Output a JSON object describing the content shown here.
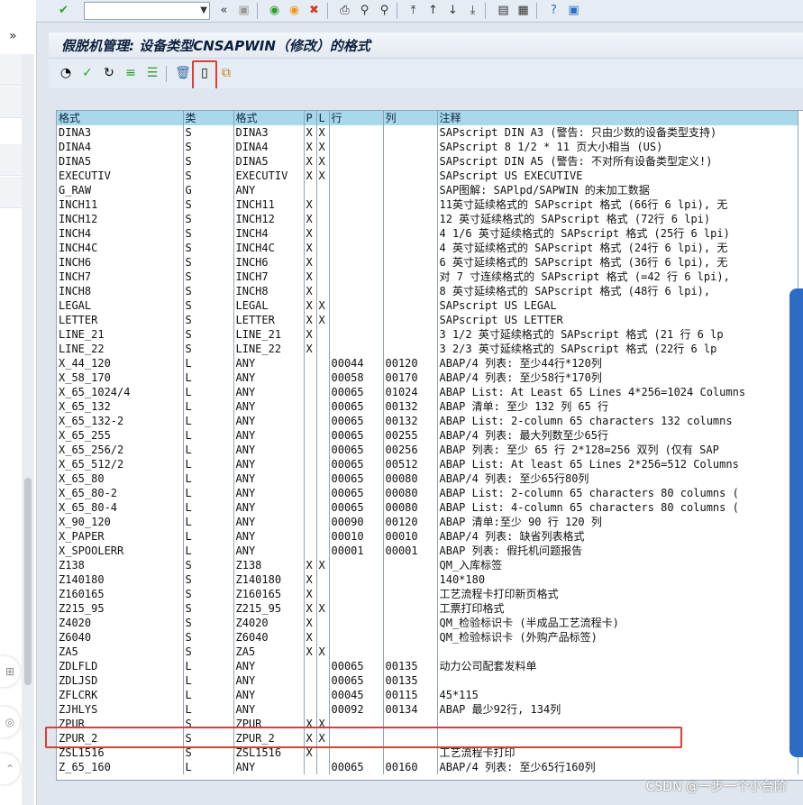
{
  "toolbar": {
    "check_icon": "✔",
    "back_icon": "«",
    "save_icon": "▣",
    "icons": [
      "green-back",
      "yellow-exit",
      "red-cancel",
      "print",
      "find",
      "find-next",
      "page-first",
      "page-prev",
      "page-next",
      "page-last",
      "create-session",
      "shortcut",
      "help",
      "customize"
    ]
  },
  "title": "假脱机管理: 设备类型CNSAPWIN（修改）的格式",
  "apptoolbar": {
    "icons": [
      "glasses",
      "check-green",
      "refresh",
      "align",
      "filter",
      "delete",
      "new-document",
      "copy"
    ]
  },
  "table": {
    "headers": [
      "格式",
      "类",
      "格式",
      "P",
      "L",
      "行",
      "列",
      "注释"
    ],
    "rows": [
      [
        "DINA3",
        "S",
        "DINA3",
        "X",
        "X",
        "",
        "",
        "SAPscript DIN A3 (警告: 只由少数的设备类型支持)"
      ],
      [
        "DINA4",
        "S",
        "DINA4",
        "X",
        "X",
        "",
        "",
        "SAPscript 8 1/2 * 11 页大小相当 (US)"
      ],
      [
        "DINA5",
        "S",
        "DINA5",
        "X",
        "X",
        "",
        "",
        "SAPscript DIN A5 (警告: 不对所有设备类型定义!)"
      ],
      [
        "EXECUTIV",
        "S",
        "EXECUTIV",
        "X",
        "X",
        "",
        "",
        "SAPscript US EXECUTIVE"
      ],
      [
        "G_RAW",
        "G",
        "ANY",
        "",
        "",
        "",
        "",
        "SAP图解: SAPlpd/SAPWIN 的未加工数据"
      ],
      [
        "INCH11",
        "S",
        "INCH11",
        "X",
        "",
        "",
        "",
        "11英寸延续格式的 SAPscript 格式 (66行 6 lpi), 无"
      ],
      [
        "INCH12",
        "S",
        "INCH12",
        "X",
        "",
        "",
        "",
        "12 英寸延续格式的 SAPscript 格式 (72行 6 lpi)"
      ],
      [
        "INCH4",
        "S",
        "INCH4",
        "X",
        "",
        "",
        "",
        "4 1/6 英寸延续格式的 SAPscript 格式 (25行 6 lpi)"
      ],
      [
        "INCH4C",
        "S",
        "INCH4C",
        "X",
        "",
        "",
        "",
        "4 英寸延续格式的 SAPscript 格式 (24行 6 lpi), 无"
      ],
      [
        "INCH6",
        "S",
        "INCH6",
        "X",
        "",
        "",
        "",
        "6 英寸延续格式的 SAPscript 格式 (36行 6 lpi), 无"
      ],
      [
        "INCH7",
        "S",
        "INCH7",
        "X",
        "",
        "",
        "",
        "对 7 寸连续格式的 SAPscript 格式 (=42 行 6 lpi),"
      ],
      [
        "INCH8",
        "S",
        "INCH8",
        "X",
        "",
        "",
        "",
        "8 英寸延续格式的 SAPscript 格式 (48行 6 lpi),"
      ],
      [
        "LEGAL",
        "S",
        "LEGAL",
        "X",
        "X",
        "",
        "",
        "SAPscript US LEGAL"
      ],
      [
        "LETTER",
        "S",
        "LETTER",
        "X",
        "X",
        "",
        "",
        "SAPscript US LETTER"
      ],
      [
        "LINE_21",
        "S",
        "LINE_21",
        "X",
        "",
        "",
        "",
        "3 1/2 英寸延续格式的 SAPscript 格式 (21 行 6 lp"
      ],
      [
        "LINE_22",
        "S",
        "LINE_22",
        "X",
        "",
        "",
        "",
        "3 2/3 英寸延续格式的 SAPscript 格式 (22行 6 lp"
      ],
      [
        "X_44_120",
        "L",
        "ANY",
        "",
        "",
        "00044",
        "00120",
        "ABAP/4 列表: 至少44行*120列"
      ],
      [
        "X_58_170",
        "L",
        "ANY",
        "",
        "",
        "00058",
        "00170",
        "ABAP/4 列表: 至少58行*170列"
      ],
      [
        "X_65_1024/4",
        "L",
        "ANY",
        "",
        "",
        "00065",
        "01024",
        "ABAP List: At Least 65 Lines 4*256=1024 Columns"
      ],
      [
        "X_65_132",
        "L",
        "ANY",
        "",
        "",
        "00065",
        "00132",
        "ABAP 清单: 至少 132 列 65 行"
      ],
      [
        "X_65_132-2",
        "L",
        "ANY",
        "",
        "",
        "00065",
        "00132",
        "ABAP List: 2-column 65 characters 132 columns"
      ],
      [
        "X_65_255",
        "L",
        "ANY",
        "",
        "",
        "00065",
        "00255",
        "ABAP/4 列表: 最大列数至少65行"
      ],
      [
        "X_65_256/2",
        "L",
        "ANY",
        "",
        "",
        "00065",
        "00256",
        "ABAP 列表: 至少 65 行 2*128=256 双列 (仅有 SAP"
      ],
      [
        "X_65_512/2",
        "L",
        "ANY",
        "",
        "",
        "00065",
        "00512",
        "ABAP List:  At least 65 Lines 2*256=512 Columns"
      ],
      [
        "X_65_80",
        "L",
        "ANY",
        "",
        "",
        "00065",
        "00080",
        "ABAP/4 列表: 至少65行80列"
      ],
      [
        "X_65_80-2",
        "L",
        "ANY",
        "",
        "",
        "00065",
        "00080",
        "ABAP List: 2-column 65 characters 80 columns ("
      ],
      [
        "X_65_80-4",
        "L",
        "ANY",
        "",
        "",
        "00065",
        "00080",
        "ABAP List: 4-column 65 characters 80 columns ("
      ],
      [
        "X_90_120",
        "L",
        "ANY",
        "",
        "",
        "00090",
        "00120",
        "ABAP 清单:至少 90 行 120 列"
      ],
      [
        "X_PAPER",
        "L",
        "ANY",
        "",
        "",
        "00010",
        "00010",
        "ABAP/4 列表: 缺省列表格式"
      ],
      [
        "X_SPOOLERR",
        "L",
        "ANY",
        "",
        "",
        "00001",
        "00001",
        "ABAP 列表: 假托机问题报告"
      ],
      [
        "Z138",
        "S",
        "Z138",
        "X",
        "X",
        "",
        "",
        "QM_入库标签"
      ],
      [
        "Z140180",
        "S",
        "Z140180",
        "X",
        "",
        "",
        "",
        "140*180"
      ],
      [
        "Z160165",
        "S",
        "Z160165",
        "X",
        "",
        "",
        "",
        "工艺流程卡打印新页格式"
      ],
      [
        "Z215_95",
        "S",
        "Z215_95",
        "X",
        "X",
        "",
        "",
        "工票打印格式"
      ],
      [
        "Z4020",
        "S",
        "Z4020",
        "X",
        "",
        "",
        "",
        "QM_检验标识卡 (半成品工艺流程卡)"
      ],
      [
        "Z6040",
        "S",
        "Z6040",
        "X",
        "",
        "",
        "",
        "QM_检验标识卡 (外购产品标签)"
      ],
      [
        "ZA5",
        "S",
        "ZA5",
        "X",
        "X",
        "",
        "",
        ""
      ],
      [
        "ZDLFLD",
        "L",
        "ANY",
        "",
        "",
        "00065",
        "00135",
        "动力公司配套发料单"
      ],
      [
        "ZDLJSD",
        "L",
        "ANY",
        "",
        "",
        "00065",
        "00135",
        ""
      ],
      [
        "ZFLCRK",
        "L",
        "ANY",
        "",
        "",
        "00045",
        "00115",
        "45*115"
      ],
      [
        "ZJHLYS",
        "L",
        "ANY",
        "",
        "",
        "00092",
        "00134",
        "ABAP 最少92行, 134列"
      ],
      [
        "ZPUR",
        "S",
        "ZPUR",
        "X",
        "X",
        "",
        "",
        ""
      ],
      [
        "ZPUR_2",
        "S",
        "ZPUR_2",
        "X",
        "X",
        "",
        "",
        ""
      ],
      [
        "ZSL1516",
        "S",
        "ZSL1516",
        "X",
        "",
        "",
        "",
        "工艺流程卡打印"
      ],
      [
        "Z_65_160",
        "L",
        "ANY",
        "",
        "",
        "00065",
        "00160",
        "ABAP/4 列表: 至少65行160列"
      ]
    ]
  },
  "watermark": "CSDN @一步一个小台阶"
}
